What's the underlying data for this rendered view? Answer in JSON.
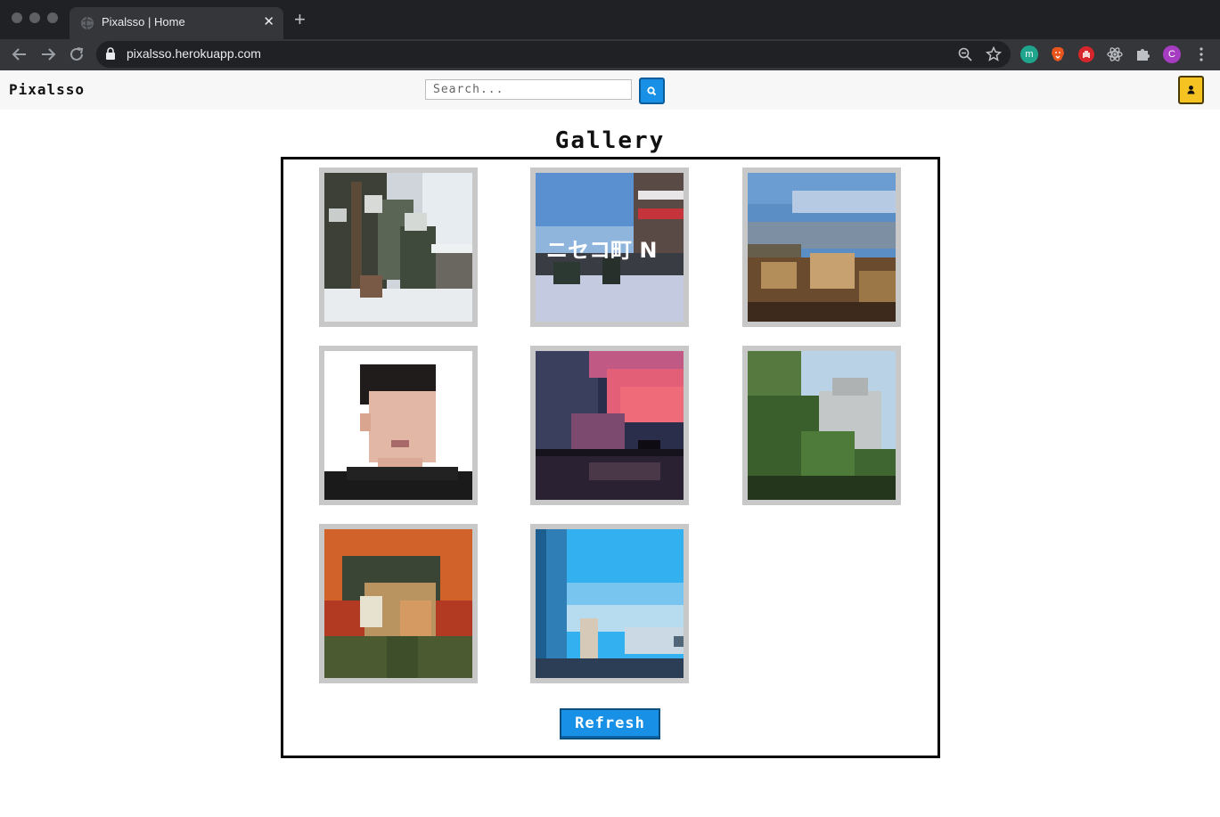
{
  "browser": {
    "tab_title": "Pixalsso | Home",
    "url": "pixalsso.herokuapp.com",
    "close_glyph": "✕",
    "new_tab_glyph": "+",
    "extension_m_label": "m",
    "profile_initial": "C"
  },
  "navbar": {
    "brand": "Pixalsso",
    "search_placeholder": "Search..."
  },
  "gallery": {
    "title": "Gallery",
    "images": [
      {
        "subject": "snowy-forest"
      },
      {
        "subject": "ski-resort",
        "overlay_text": "ニセコ町 N"
      },
      {
        "subject": "mountain-autumn"
      },
      {
        "subject": "portrait-man"
      },
      {
        "subject": "pink-sunset-pier"
      },
      {
        "subject": "garden-building"
      },
      {
        "subject": "van-gogh-self-portrait"
      },
      {
        "subject": "blue-sky-pixels"
      }
    ],
    "refresh_label": "Refresh"
  }
}
